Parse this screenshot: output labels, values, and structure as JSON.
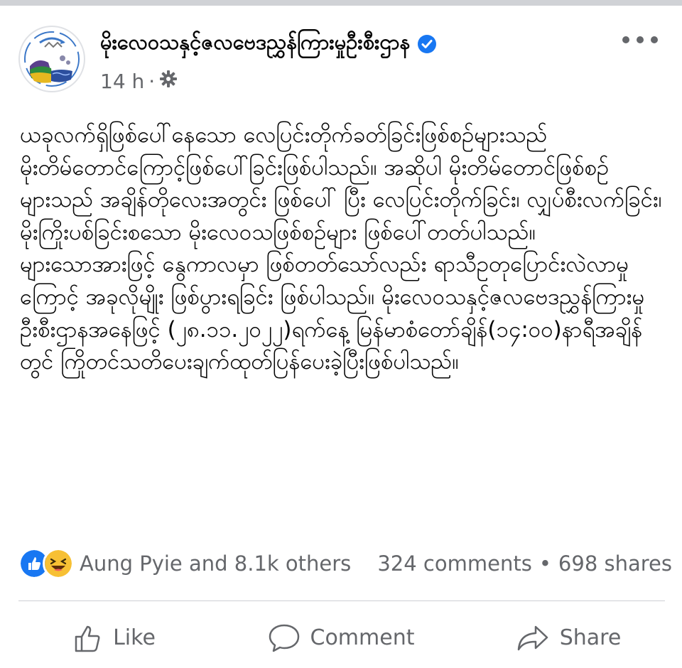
{
  "post": {
    "page_name": "မိုးလေဝသနှင့်ဇလဗေဒညွှန်ကြားမှုဦးစီးဌာန",
    "time": "14 h",
    "separator": "·",
    "privacy_icon": "gear-icon",
    "more_icon": "more-dots-icon",
    "text": "ယခုလက်ရှိဖြစ်ပေါ်နေသော လေပြင်းတိုက်ခတ်ခြင်းဖြစ်စဉ်များသည်\nမိုးတိမ်တောင်ကြောင့်ဖြစ်ပေါ်ခြင်းဖြစ်ပါသည်။ အဆိုပါ မိုးတိမ်တောင်ဖြစ်စဉ်များသည် အချိန်တိုလေးအတွင်း ဖြစ်ပေါ် ပြီး လေပြင်းတိုက်ခြင်း၊ လျှပ်စီးလက်ခြင်း၊ မိုးကြိုးပစ်ခြင်းစသော မိုးလေဝသဖြစ်စဉ်များ ဖြစ်ပေါ်တတ်ပါသည်။ များသောအားဖြင့် နွေကာလမှာ ဖြစ်တတ်သော်လည်း ရာသီဥတုပြောင်းလဲလာမှုကြောင့် အခုလိုမျိုး ဖြစ်ပွားရခြင်း ဖြစ်ပါသည်။ မိုးလေဝသနှင့်ဇလဗေဒညွှန်ကြားမှုဦးစီးဌာနအနေဖြင့် (၂၈.၁၁.၂၀၂၂)ရက်နေ့ မြန်မာစံတော်ချိန်(၁၄:၀၀)နာရီအချိန်တွင် ကြိုတင်သတိပေးချက်ထုတ်ပြန်ပေးခဲ့ပြီးဖြစ်ပါသည်။"
  },
  "reactions": {
    "icons": [
      "like-reaction-icon",
      "haha-reaction-icon"
    ],
    "summary": "Aung Pyie and 8.1k others",
    "comments": "324 comments",
    "bullet": "•",
    "shares": "698 shares"
  },
  "actions": {
    "like": "Like",
    "comment": "Comment",
    "share": "Share"
  },
  "colors": {
    "verified_blue": "#1877f2",
    "meta_gray": "#65676b",
    "text_dark": "#050505"
  }
}
